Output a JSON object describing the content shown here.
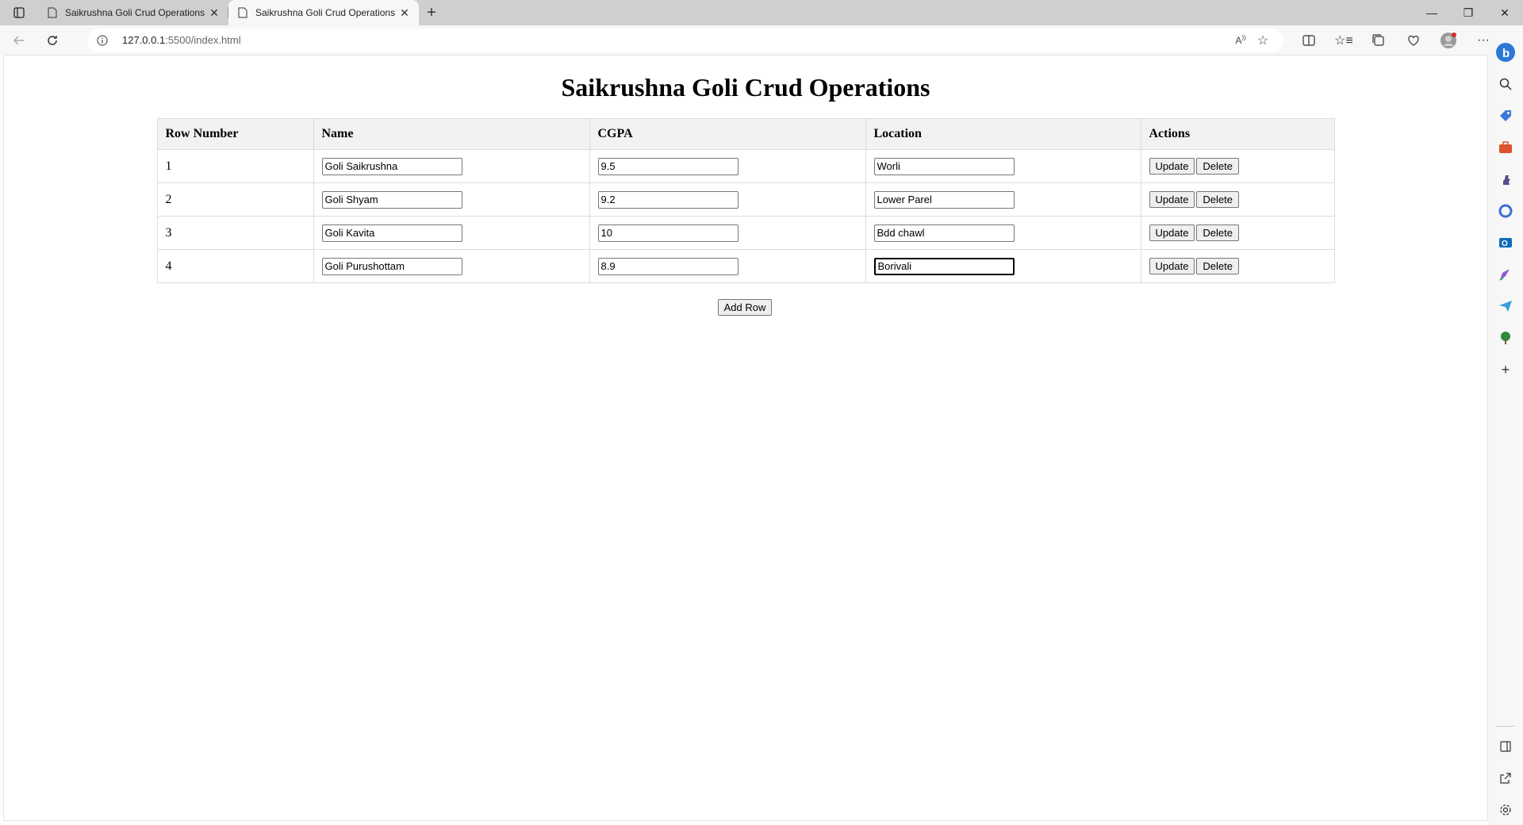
{
  "browser": {
    "tabs": [
      {
        "title": "Saikrushna Goli Crud Operations",
        "active": false
      },
      {
        "title": "Saikrushna Goli Crud Operations",
        "active": true
      }
    ],
    "address": {
      "host": "127.0.0.1",
      "path": ":5500/index.html"
    }
  },
  "page": {
    "title": "Saikrushna Goli Crud Operations",
    "table": {
      "headers": {
        "row_number": "Row Number",
        "name": "Name",
        "cgpa": "CGPA",
        "location": "Location",
        "actions": "Actions"
      },
      "rows": [
        {
          "num": "1",
          "name": "Goli Saikrushna",
          "cgpa": "9.5",
          "location": "Worli"
        },
        {
          "num": "2",
          "name": "Goli Shyam",
          "cgpa": "9.2",
          "location": "Lower Parel"
        },
        {
          "num": "3",
          "name": "Goli Kavita",
          "cgpa": "10",
          "location": "Bdd chawl"
        },
        {
          "num": "4",
          "name": "Goli Purushottam",
          "cgpa": "8.9",
          "location": "Borivali"
        }
      ],
      "update_label": "Update",
      "delete_label": "Delete"
    },
    "add_row_label": "Add Row"
  }
}
